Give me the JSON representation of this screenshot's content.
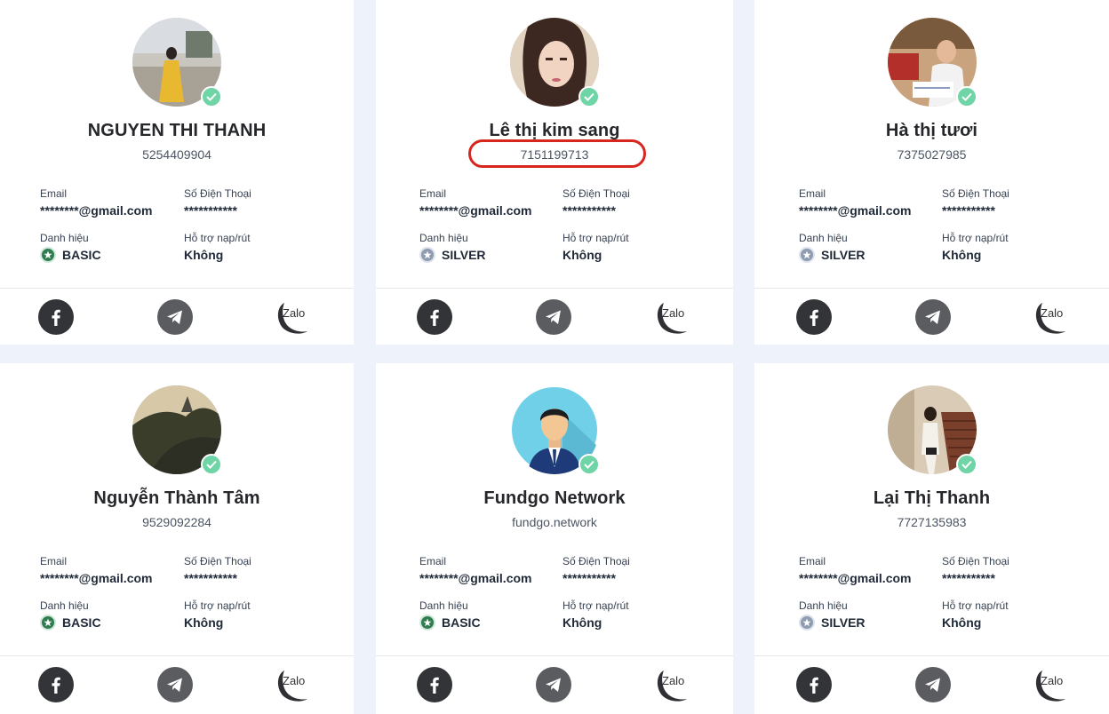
{
  "labels": {
    "email": "Email",
    "phone": "Số Điện Thoại",
    "rank": "Danh hiệu",
    "support": "Hỗ trợ nạp/rút",
    "zalo": "Zalo"
  },
  "cards": [
    {
      "name": "NGUYEN THI THANH",
      "uid": "5254409904",
      "email": "********@gmail.com",
      "phone": "***********",
      "rank": "BASIC",
      "support": "Không"
    },
    {
      "name": "Lê thị kim sang",
      "uid": "7151199713",
      "email": "********@gmail.com",
      "phone": "***********",
      "rank": "SILVER",
      "support": "Không"
    },
    {
      "name": "Hà thị tươi",
      "uid": "7375027985",
      "email": "********@gmail.com",
      "phone": "***********",
      "rank": "SILVER",
      "support": "Không"
    },
    {
      "name": "Nguyễn Thành Tâm",
      "uid": "9529092284",
      "email": "********@gmail.com",
      "phone": "***********",
      "rank": "BASIC",
      "support": "Không"
    },
    {
      "name": "Fundgo Network",
      "uid": "fundgo.network",
      "email": "********@gmail.com",
      "phone": "***********",
      "rank": "BASIC",
      "support": "Không"
    },
    {
      "name": "Lại Thị Thanh",
      "uid": "7727135983",
      "email": "********@gmail.com",
      "phone": "***********",
      "rank": "SILVER",
      "support": "Không"
    }
  ],
  "colors": {
    "verified": "#6fd4a6",
    "highlight_ring": "#d6261e",
    "rank_basic": "#2f7d4f",
    "rank_silver": "#8f9bb0"
  },
  "icons": [
    "verified-check-icon",
    "facebook-icon",
    "telegram-icon",
    "zalo-icon",
    "rank-star-icon"
  ]
}
